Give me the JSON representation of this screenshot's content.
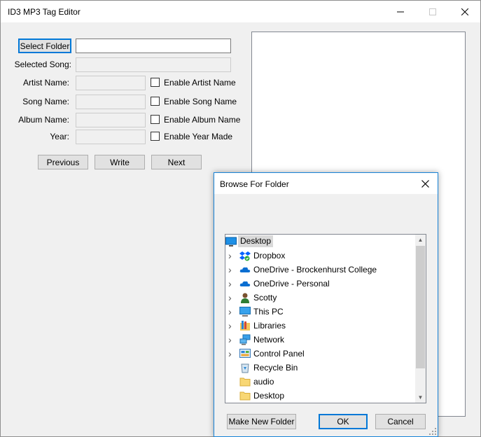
{
  "window": {
    "title": "ID3 MP3 Tag Editor"
  },
  "form": {
    "select_folder_label": "Select Folder",
    "folder_value": "",
    "selected_song_label": "Selected Song:",
    "artist_label": "Artist Name:",
    "song_label": "Song Name:",
    "album_label": "Album Name:",
    "year_label": "Year:",
    "enable_artist": "Enable Artist Name",
    "enable_song": "Enable Song Name",
    "enable_album": "Enable Album Name",
    "enable_year": "Enable Year Made",
    "previous": "Previous",
    "write": "Write",
    "next": "Next"
  },
  "dialog": {
    "title": "Browse For Folder",
    "items": [
      {
        "label": "Desktop",
        "icon": "desktop-icon",
        "selected": true,
        "expandable": false
      },
      {
        "label": "Dropbox",
        "icon": "dropbox-icon",
        "expandable": true
      },
      {
        "label": "OneDrive - Brockenhurst College",
        "icon": "onedrive-icon",
        "expandable": true
      },
      {
        "label": "OneDrive - Personal",
        "icon": "onedrive-icon",
        "expandable": true
      },
      {
        "label": "Scotty",
        "icon": "user-icon",
        "expandable": true
      },
      {
        "label": "This PC",
        "icon": "computer-icon",
        "expandable": true
      },
      {
        "label": "Libraries",
        "icon": "libraries-icon",
        "expandable": true
      },
      {
        "label": "Network",
        "icon": "network-icon",
        "expandable": true
      },
      {
        "label": "Control Panel",
        "icon": "control-panel-icon",
        "expandable": true
      },
      {
        "label": "Recycle Bin",
        "icon": "recycle-bin-icon",
        "expandable": false
      },
      {
        "label": "audio",
        "icon": "folder-icon",
        "expandable": false
      },
      {
        "label": "Desktop",
        "icon": "folder-icon",
        "expandable": false
      }
    ],
    "make_new_folder": "Make New Folder",
    "ok": "OK",
    "cancel": "Cancel"
  }
}
